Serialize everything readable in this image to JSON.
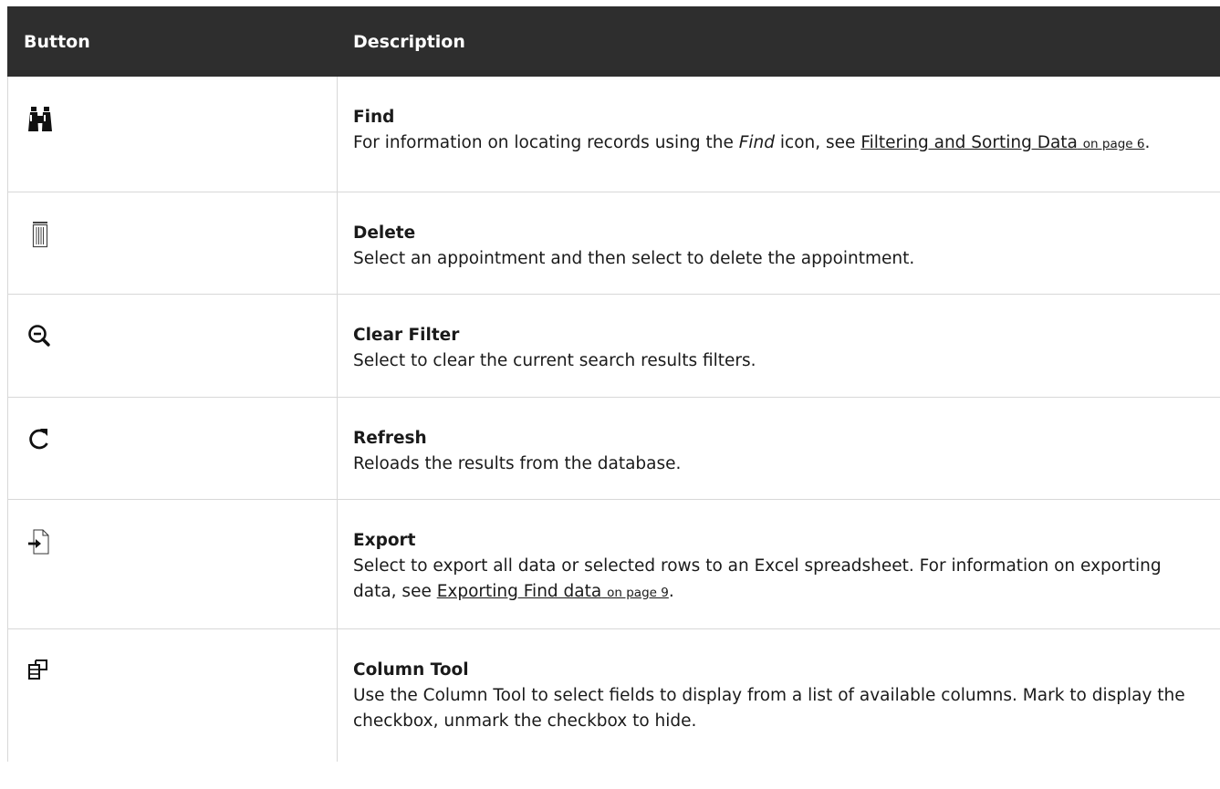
{
  "table": {
    "header": {
      "col1": "Button",
      "col2": "Description"
    },
    "rows": [
      {
        "icon": "binoculars-icon",
        "title": "Find",
        "desc_pre": "For information on locating records using the ",
        "desc_em": "Find",
        "desc_mid": " icon, see ",
        "link_text": "Filtering and Sorting Data",
        "link_page": "on page 6",
        "desc_post": "."
      },
      {
        "icon": "trash-icon",
        "title": "Delete",
        "desc": "Select an appointment and then select to delete the appointment."
      },
      {
        "icon": "zoom-out-icon",
        "title": "Clear Filter",
        "desc": "Select to clear the current search results filters."
      },
      {
        "icon": "refresh-icon",
        "title": "Refresh",
        "desc": "Reloads the results from the database."
      },
      {
        "icon": "export-icon",
        "title": "Export",
        "desc_pre": "Select to export all data or selected rows to an Excel spreadsheet. For information on exporting data, see ",
        "link_text": "Exporting Find data",
        "link_page": "on page 9",
        "desc_post": "."
      },
      {
        "icon": "column-tool-icon",
        "title": "Column Tool",
        "desc": "Use the Column Tool to select fields to display from a list of available columns. Mark to display the checkbox, unmark the checkbox to hide."
      }
    ]
  }
}
